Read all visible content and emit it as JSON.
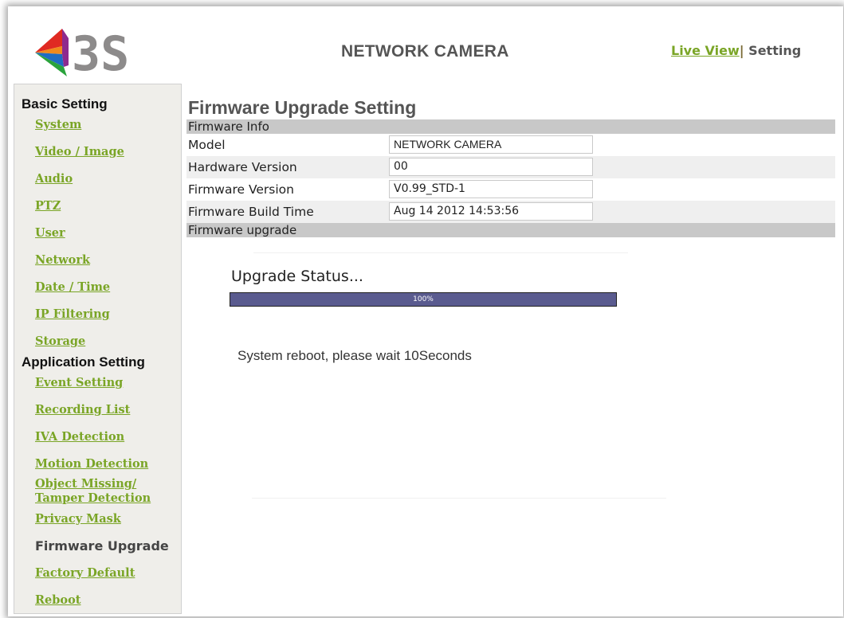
{
  "header": {
    "title": "NETWORK CAMERA",
    "live_view": "Live View",
    "separator": "|",
    "setting": "Setting",
    "logo_text": "3S"
  },
  "sidebar": {
    "basic_title": "Basic Setting",
    "basic_items": [
      "System",
      "Video / Image",
      "Audio",
      "PTZ",
      "User",
      "Network",
      "Date / Time",
      "IP Filtering",
      "Storage"
    ],
    "app_title": "Application Setting",
    "app_items": [
      "Event Setting",
      "Recording List",
      "IVA Detection",
      "Motion Detection",
      "Object Missing/",
      "Tamper Detection",
      "Privacy Mask",
      "Firmware Upgrade",
      "Factory Default",
      "Reboot"
    ],
    "current": "Firmware Upgrade"
  },
  "main": {
    "title": "Firmware Upgrade Setting",
    "info_header": "Firmware Info",
    "rows": [
      {
        "label": "Model",
        "value": "NETWORK CAMERA"
      },
      {
        "label": "Hardware Version",
        "value": "00"
      },
      {
        "label": "Firmware Version",
        "value": "V0.99_STD-1"
      },
      {
        "label": "Firmware Build Time",
        "value": "Aug 14 2012 14:53:56"
      }
    ],
    "upgrade_header": "Firmware upgrade",
    "status_label": "Upgrade Status...",
    "progress_text": "100%",
    "progress_value": 1.0,
    "reboot_message": "System reboot, please wait 10Seconds"
  },
  "colors": {
    "link_green": "#7aa526",
    "progress_fill": "#5a5b8f",
    "bar_gray": "#c8c8c8",
    "sidebar_bg": "#efeeea"
  }
}
